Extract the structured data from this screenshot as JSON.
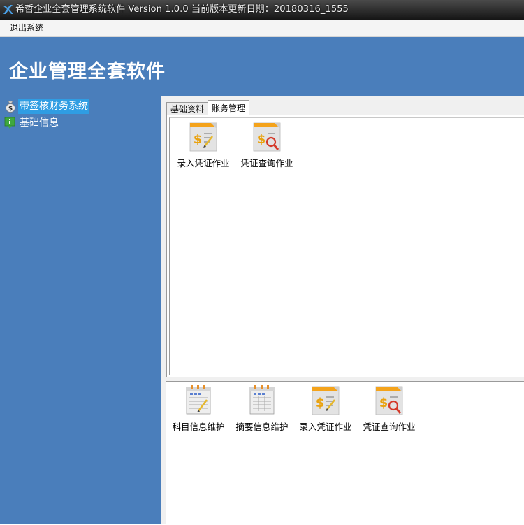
{
  "window": {
    "title": "希哲企业全套管理系统软件 Version 1.0.0 当前版本更新日期：20180316_1555"
  },
  "menubar": {
    "items": [
      {
        "label": "退出系统"
      }
    ]
  },
  "header": {
    "app_title": "企业管理全套软件"
  },
  "sidebar": {
    "items": [
      {
        "label": "带签核财务系统",
        "icon": "money-bag-icon",
        "selected": true
      },
      {
        "label": "基础信息",
        "icon": "info-icon",
        "selected": false
      }
    ]
  },
  "tabs": {
    "items": [
      {
        "label": "基础资料",
        "active": false
      },
      {
        "label": "账务管理",
        "active": true
      }
    ]
  },
  "top_tiles": [
    {
      "label": "录入凭证作业",
      "icon": "voucher-entry-icon"
    },
    {
      "label": "凭证查询作业",
      "icon": "voucher-query-icon"
    }
  ],
  "bottom_tiles": [
    {
      "label": "科目信息维护",
      "icon": "account-maintenance-icon"
    },
    {
      "label": "摘要信息维护",
      "icon": "summary-maintenance-icon"
    },
    {
      "label": "录入凭证作业",
      "icon": "voucher-entry-icon"
    },
    {
      "label": "凭证查询作业",
      "icon": "voucher-query-icon"
    }
  ],
  "colors": {
    "header_blue": "#4a7ebb",
    "selection_blue": "#2f9de3",
    "titlebar_dark": "#151515"
  }
}
